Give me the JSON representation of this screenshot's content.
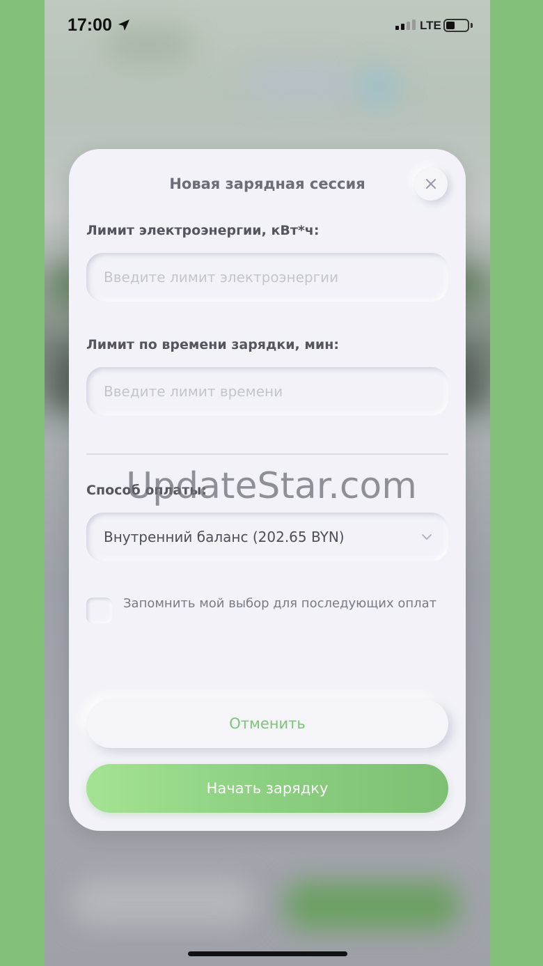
{
  "status_bar": {
    "time": "17:00",
    "network": "LTE"
  },
  "modal": {
    "title": "Новая зарядная сессия",
    "energy_limit": {
      "label": "Лимит электроэнергии, кВт*ч:",
      "placeholder": "Введите лимит электроэнергии"
    },
    "time_limit": {
      "label": "Лимит по времени зарядки, мин:",
      "placeholder": "Введите лимит времени"
    },
    "payment": {
      "label": "Способ оплаты:",
      "selected": "Внутренний баланс (202.65 BYN)"
    },
    "remember_choice": {
      "label": "Запомнить мой выбор для последующих оплат",
      "checked": false
    },
    "cancel_label": "Отменить",
    "start_label": "Начать зарядку"
  },
  "watermark": "UpdateStar.com",
  "colors": {
    "accent": "#7cc477",
    "start_gradient_from": "#a4e393",
    "start_gradient_to": "#7ec073",
    "outer_background": "#83c07a",
    "modal_background": "#f2f2f8"
  },
  "icons": [
    "location-arrow-icon",
    "signal-icon",
    "battery-icon",
    "close-icon",
    "chevron-down-icon"
  ]
}
